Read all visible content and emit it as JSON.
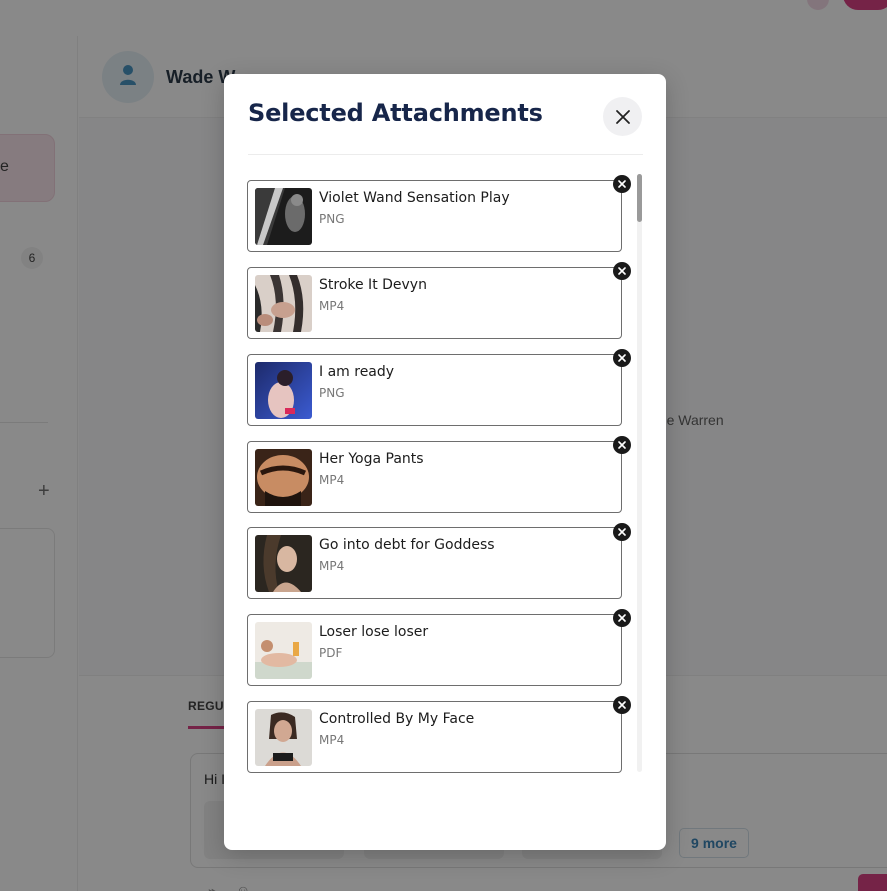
{
  "background": {
    "sidebar_card_text": "e",
    "sidebar_badge": "6",
    "sidebar_plus": "+",
    "chat_name": "Wade W",
    "chat_label": "ade Warren",
    "tab_label": "REGUL",
    "input_text": "Hi I",
    "more_chip": "9 more"
  },
  "modal": {
    "title": "Selected Attachments",
    "close_icon": "close-icon",
    "attachments": [
      {
        "title": "Violet Wand Sensation Play",
        "type": "PNG"
      },
      {
        "title": "Stroke It Devyn",
        "type": "MP4"
      },
      {
        "title": "I am ready",
        "type": "PNG"
      },
      {
        "title": "Her Yoga Pants",
        "type": "MP4"
      },
      {
        "title": "Go into debt for Goddess",
        "type": "MP4"
      },
      {
        "title": "Loser lose loser",
        "type": "PDF"
      },
      {
        "title": "Controlled By My Face",
        "type": "MP4"
      }
    ]
  },
  "colors": {
    "accent": "#d6337a",
    "title": "#17264a",
    "link": "#2c7ab0"
  }
}
